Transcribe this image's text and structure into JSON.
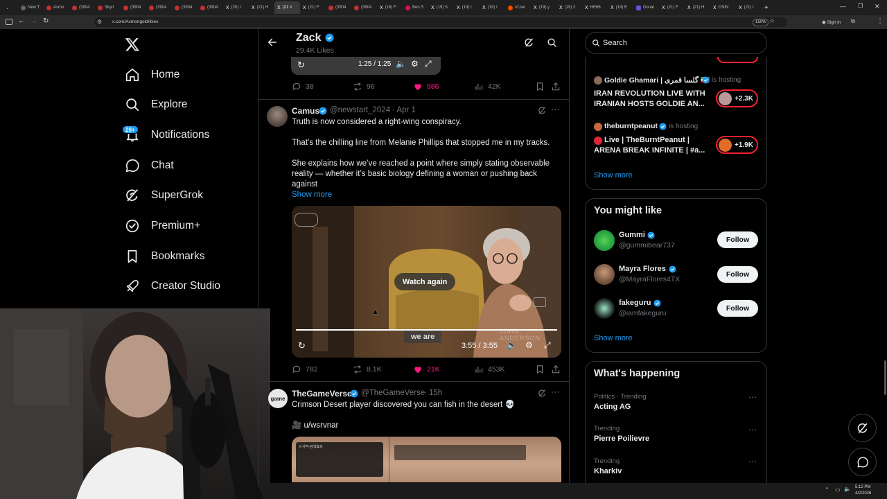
{
  "browser": {
    "tabs": [
      "New T",
      "Asmo",
      "(3904",
      "Skyri",
      "(3904",
      "(3904",
      "(3904",
      "(3904",
      "(20) I",
      "(21) H",
      "(21 ×",
      "(21) F",
      "(3904",
      "(3904",
      "(16) F",
      "Ben S",
      "(19) S",
      "(19) I",
      "(19) I",
      "r/Live",
      "(19) y",
      "(19) 2",
      "HE66",
      "(19) E",
      "Donal",
      "(21) F",
      "(21) H",
      "OSIN",
      "(21) I"
    ],
    "url": "x.com/Asmongold/likes",
    "zoom": "150%",
    "signin": "Sign in",
    "clock_time": "5:12 PM",
    "clock_date": "4/2/2026"
  },
  "nav": {
    "home": "Home",
    "explore": "Explore",
    "notifications": "Notifications",
    "notifications_badge": "20+",
    "chat": "Chat",
    "supergrok": "SuperGrok",
    "premium": "Premium+",
    "bookmarks": "Bookmarks",
    "creator_studio": "Creator Studio"
  },
  "header": {
    "name": "Zack",
    "likes": "29.4K Likes"
  },
  "prev_tweet": {
    "video_time": "1:25 / 1:25",
    "replies": "38",
    "reposts": "96",
    "likes": "986",
    "views": "42K"
  },
  "tweet1": {
    "name": "Camus",
    "handle": "@newstart_2024",
    "date": "· Apr 1",
    "line1": "Truth is now considered a right-wing conspiracy.",
    "line2": "That’s the chilling line from Melanie Phillips that stopped me in my tracks.",
    "line3a": "She explains how we’ve reached a point where simply stating observable",
    "line3b": "reality — whether it’s basic biology defining a woman or pushing back",
    "line3c": "against",
    "show_more": "Show more",
    "watch_again": "Watch again",
    "caption": "we are",
    "watermark": "JOHN ANDERSON",
    "video_time": "3:55 / 3:55",
    "replies": "782",
    "reposts": "8.1K",
    "likes": "21K",
    "views": "453K"
  },
  "tweet2": {
    "name": "TheGameVerse",
    "handle": "@TheGameVerse",
    "date": "· 15h",
    "text": "Crimson Desert player discovered you can fish in the desert 💀",
    "source": "🎥 u/wsrvnar",
    "avatar_text": "game",
    "img_title": "# 사막-검색효과"
  },
  "search": {
    "placeholder": "Search"
  },
  "live": {
    "host1_name": "Goldie Ghamari | گلسا قمری 🇮🇷",
    "host1_status": "is hosting",
    "host1_title_a": "IRAN REVOLUTION LIVE WITH",
    "host1_title_b": "IRANIAN HOSTS GOLDIE AN...",
    "host1_count": "+2.3K",
    "host2_name": "theburntpeanut",
    "host2_status": "is hosting",
    "host2_title_a": "Live | TheBurntPeanut |",
    "host2_title_b": "ARENA BREAK INFINITE | #a...",
    "host2_count": "+1.9K",
    "show_more": "Show more"
  },
  "suggest": {
    "title": "You might like",
    "users": [
      {
        "name": "Gummi",
        "handle": "@gummibear737",
        "button": "Follow"
      },
      {
        "name": "Mayra Flores",
        "handle": "@MayraFlores4TX",
        "button": "Follow"
      },
      {
        "name": "fakeguru",
        "handle": "@iamfakeguru",
        "button": "Follow"
      }
    ],
    "show_more": "Show more"
  },
  "trends": {
    "title": "What's happening",
    "items": [
      {
        "category": "Politics · Trending",
        "name": "Acting AG"
      },
      {
        "category": "Trending",
        "name": "Pierre Poilievre"
      },
      {
        "category": "Trending",
        "name": "Kharkiv"
      }
    ]
  },
  "colors": {
    "accent": "#1d9bf0",
    "like": "#f91880",
    "muted": "#71767b",
    "live_border": "#f4212e"
  }
}
